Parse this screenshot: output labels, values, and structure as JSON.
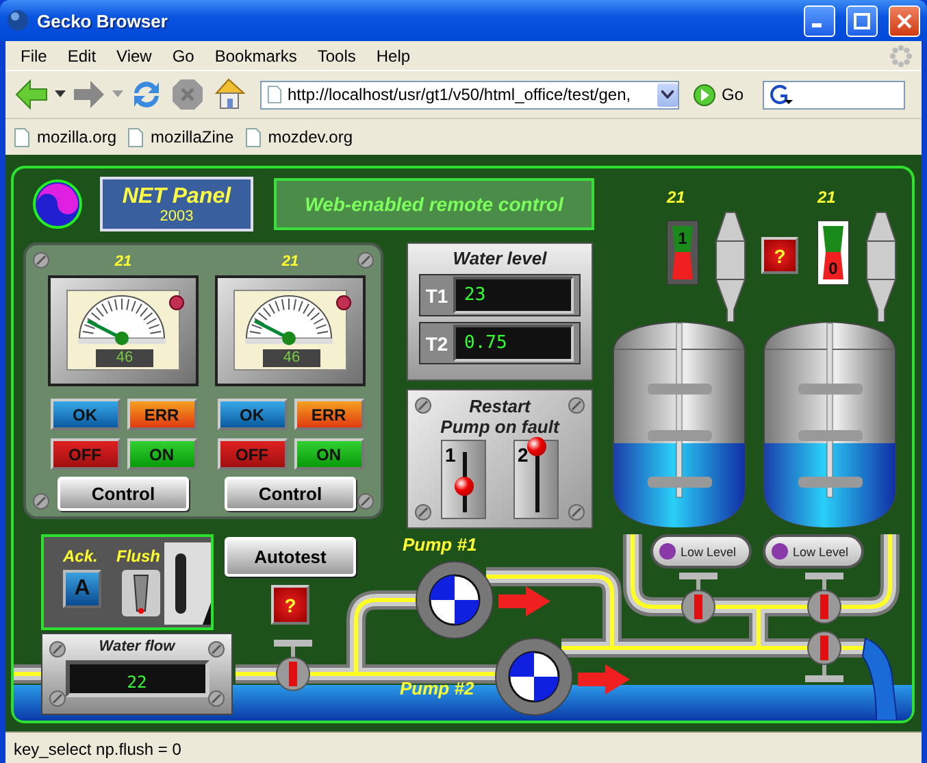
{
  "window": {
    "title": "Gecko Browser"
  },
  "menu": [
    "File",
    "Edit",
    "View",
    "Go",
    "Bookmarks",
    "Tools",
    "Help"
  ],
  "toolbar": {
    "url": "http://localhost/usr/gt1/v50/html_office/test/gen,",
    "go": "Go"
  },
  "bookmarks": [
    "mozilla.org",
    "mozillaZine",
    "mozdev.org"
  ],
  "panel": {
    "logo_title": "NET Panel",
    "logo_year": "2003",
    "banner": "Web-enabled remote control",
    "pumps_control": [
      {
        "label": "21",
        "reading": "46",
        "buttons": [
          {
            "label": "OK",
            "kind": "ok"
          },
          {
            "label": "ERR",
            "kind": "err"
          },
          {
            "label": "OFF",
            "kind": "off"
          },
          {
            "label": "ON",
            "kind": "on"
          }
        ],
        "control": "Control"
      },
      {
        "label": "21",
        "reading": "46",
        "buttons": [
          {
            "label": "OK",
            "kind": "ok"
          },
          {
            "label": "ERR",
            "kind": "err"
          },
          {
            "label": "OFF",
            "kind": "off"
          },
          {
            "label": "ON",
            "kind": "on"
          }
        ],
        "control": "Control"
      }
    ],
    "water_level": {
      "title": "Water level",
      "rows": [
        {
          "label": "T1",
          "value": "23"
        },
        {
          "label": "T2",
          "value": "0.75"
        }
      ]
    },
    "restart": {
      "title": [
        "Restart",
        "Pump on fault"
      ],
      "switches": [
        {
          "label": "1",
          "on": false
        },
        {
          "label": "2",
          "on": true
        }
      ]
    },
    "tanks": [
      {
        "label": "21",
        "indicator": {
          "value": "1",
          "on": true
        },
        "level": 0.48,
        "alarm": "Low Level"
      },
      {
        "label": "21",
        "indicator": {
          "value": "0",
          "on": false
        },
        "level": 0.48,
        "alarm": "Low Level"
      }
    ],
    "tank_fault": "?",
    "ack": {
      "label": "Ack.",
      "key": "A"
    },
    "flush": {
      "label": "Flush"
    },
    "autotest": "Autotest",
    "valve_fault": "?",
    "water_flow": {
      "title": "Water flow",
      "value": "22"
    },
    "pumps": [
      {
        "label": "Pump #1"
      },
      {
        "label": "Pump #2"
      }
    ]
  },
  "status_bar": "key_select np.flush = 0"
}
